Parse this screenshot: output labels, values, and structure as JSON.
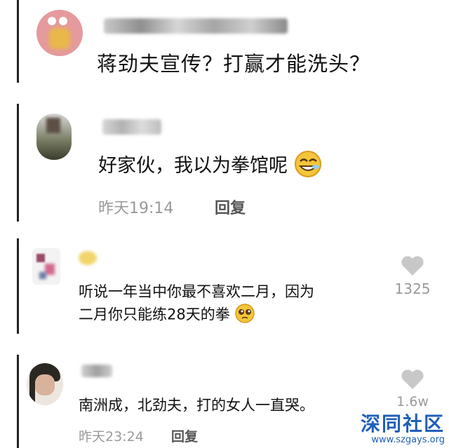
{
  "comments": [
    {
      "text": "蒋劲夫宣传？打赢才能洗头？"
    },
    {
      "text": "好家伙，我以为拳馆呢",
      "time": "昨天19:14",
      "reply_label": "回复",
      "emoji": "grinning-face-icon"
    },
    {
      "line1": "听说一年当中你最不喜欢二月，因为",
      "line2": "二月你只能练28天的拳",
      "likes": "1325",
      "emoji": "pleading-face-icon"
    },
    {
      "text": "南洲成，北劲夫，打的女人一直哭。",
      "likes": "1.6w",
      "time": "昨天23:24",
      "reply_label": "回复"
    }
  ],
  "watermark": {
    "title": "深同社区",
    "url": "www.szgays.org"
  },
  "colors": {
    "watermark_blue": "#1f5fb8",
    "meta_gray": "#9a9a9a",
    "heart_gray": "#c8c8c8"
  }
}
